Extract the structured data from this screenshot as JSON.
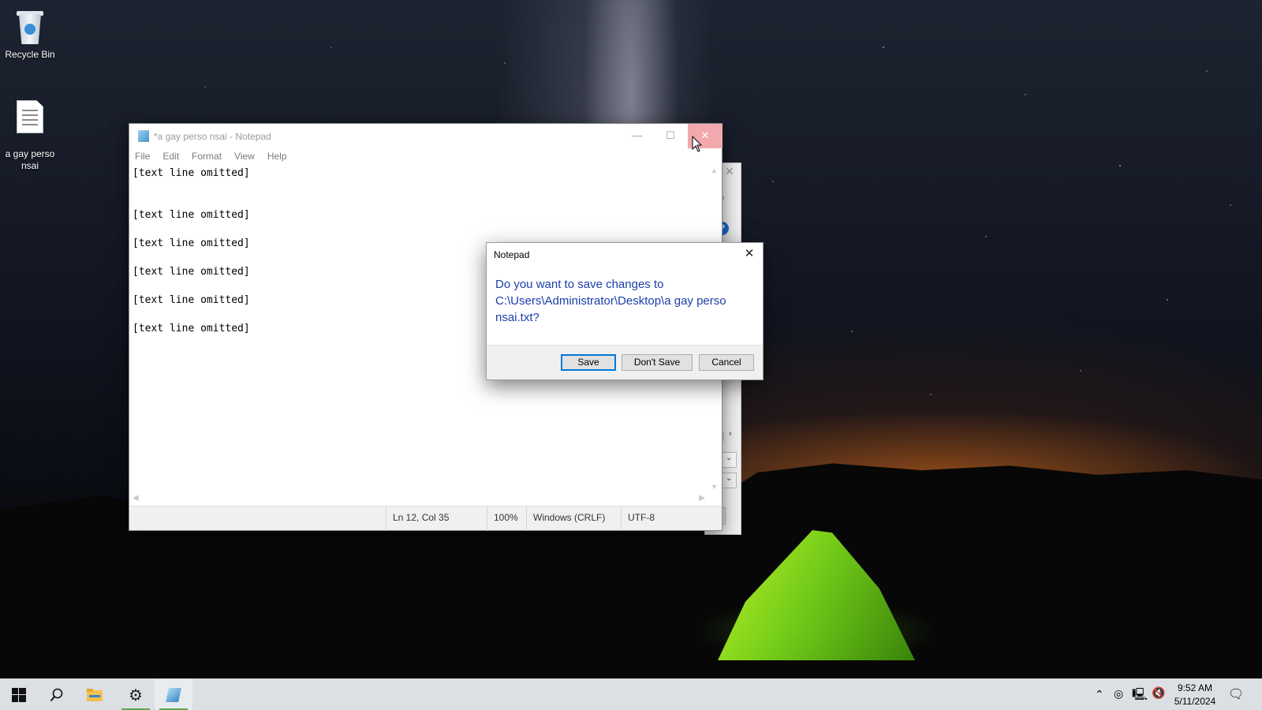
{
  "desktop": {
    "icons": [
      {
        "label": "Recycle Bin",
        "icon": "recycle-bin-icon"
      },
      {
        "label": "a gay perso\nnsai",
        "icon": "text-file-icon"
      }
    ]
  },
  "notepad": {
    "title": "*a gay perso nsai - Notepad",
    "menu": [
      "File",
      "Edit",
      "Format",
      "View",
      "Help"
    ],
    "content_lines": [
      "[text line omitted]",
      "[text line omitted]",
      "[text line omitted]",
      "[text line omitted]",
      "[text line omitted]",
      "[text line omitted]"
    ],
    "status": {
      "position": "Ln 12, Col 35",
      "zoom": "100%",
      "line_endings": "Windows (CRLF)",
      "encoding": "UTF-8"
    }
  },
  "dialog": {
    "title": "Notepad",
    "message": "Do you want to save changes to C:\\Users\\Administrator\\Desktop\\a gay perso nsai.txt?",
    "buttons": {
      "save": "Save",
      "dont_save": "Don't Save",
      "cancel": "Cancel"
    }
  },
  "taskbar": {
    "items": [
      "start-icon",
      "search-icon",
      "file-explorer-icon",
      "settings-icon",
      "notepad-icon"
    ],
    "clock": {
      "time": "9:52 AM",
      "date": "5/11/2024"
    }
  },
  "colors": {
    "close_hover": "#f1a9ae",
    "dialog_text": "#1c3fa8",
    "default_button_border": "#0078d7"
  }
}
